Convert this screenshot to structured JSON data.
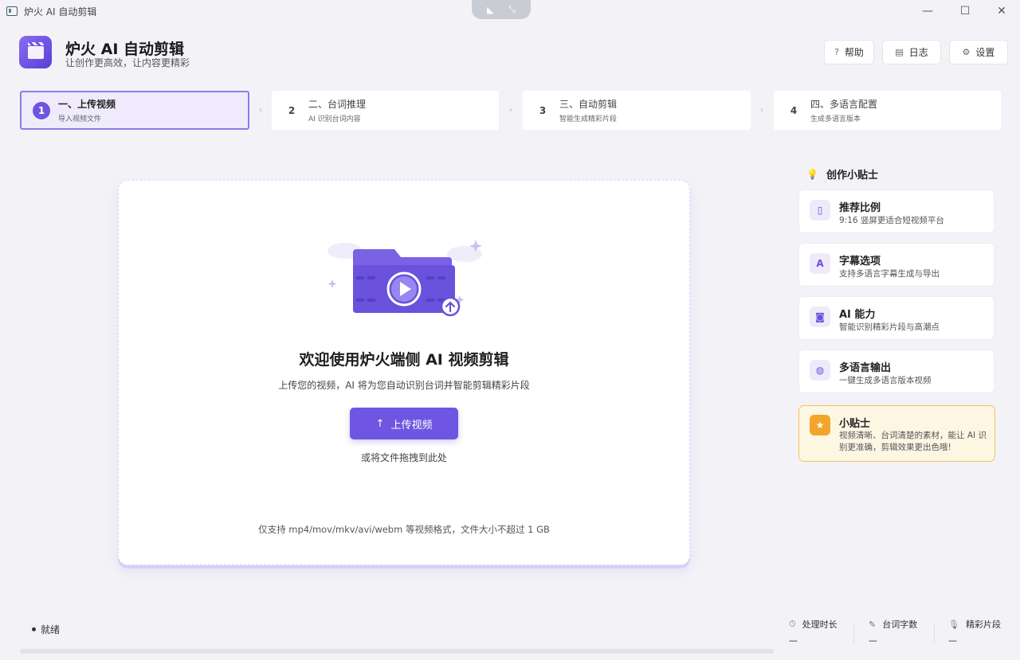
{
  "window": {
    "title": "炉火 AI 自动剪辑"
  },
  "header": {
    "title": "炉火 AI 自动剪辑",
    "subtitle": "让创作更高效，让内容更精彩",
    "buttons": {
      "help": "帮助",
      "log": "日志",
      "settings": "设置"
    }
  },
  "steps": [
    {
      "num": "1",
      "title": "一、上传视频",
      "desc": "导入视频文件",
      "active": true
    },
    {
      "num": "2",
      "title": "二、台词推理",
      "desc": "AI 识别台词内容",
      "active": false
    },
    {
      "num": "3",
      "title": "三、自动剪辑",
      "desc": "智能生成精彩片段",
      "active": false
    },
    {
      "num": "4",
      "title": "四、多语言配置",
      "desc": "生成多语言版本",
      "active": false
    }
  ],
  "upload": {
    "welcome": "欢迎使用炉火端侧 AI 视频剪辑",
    "description": "上传您的视频，AI 将为您自动识别台词并智能剪辑精彩片段",
    "button_label": "上传视频",
    "drag_hint": "或将文件拖拽到此处",
    "format_note": "仅支持 mp4/mov/mkv/avi/webm 等视频格式，文件大小不超过 1 GB"
  },
  "tips": {
    "title": "创作小贴士",
    "items": [
      {
        "icon": "ratio-icon",
        "head": "推荐比例",
        "desc": "9:16 竖屏更适合短视频平台"
      },
      {
        "icon": "subtitle-icon",
        "head": "字幕选项",
        "desc": "支持多语言字幕生成与导出"
      },
      {
        "icon": "ai-robot-icon",
        "head": "AI 能力",
        "desc": "智能识别精彩片段与高潮点"
      },
      {
        "icon": "globe-icon",
        "head": "多语言输出",
        "desc": "一键生成多语言版本视频"
      }
    ],
    "highlight": {
      "head": "小贴士",
      "desc": "视频清晰、台词清楚的素材，能让 AI 识别更准确，剪辑效果更出色哦!"
    }
  },
  "status": {
    "state": "就绪",
    "stats": [
      {
        "label": "处理时长",
        "value": "—"
      },
      {
        "label": "台词字数",
        "value": "—"
      },
      {
        "label": "精彩片段",
        "value": "—"
      }
    ],
    "progress": 0
  },
  "colors": {
    "accent": "#6e56e2",
    "active_step_bg": "#efebfd",
    "tip_highlight_bg": "#fdf6e3",
    "tip_highlight_border": "#f3c35a"
  }
}
